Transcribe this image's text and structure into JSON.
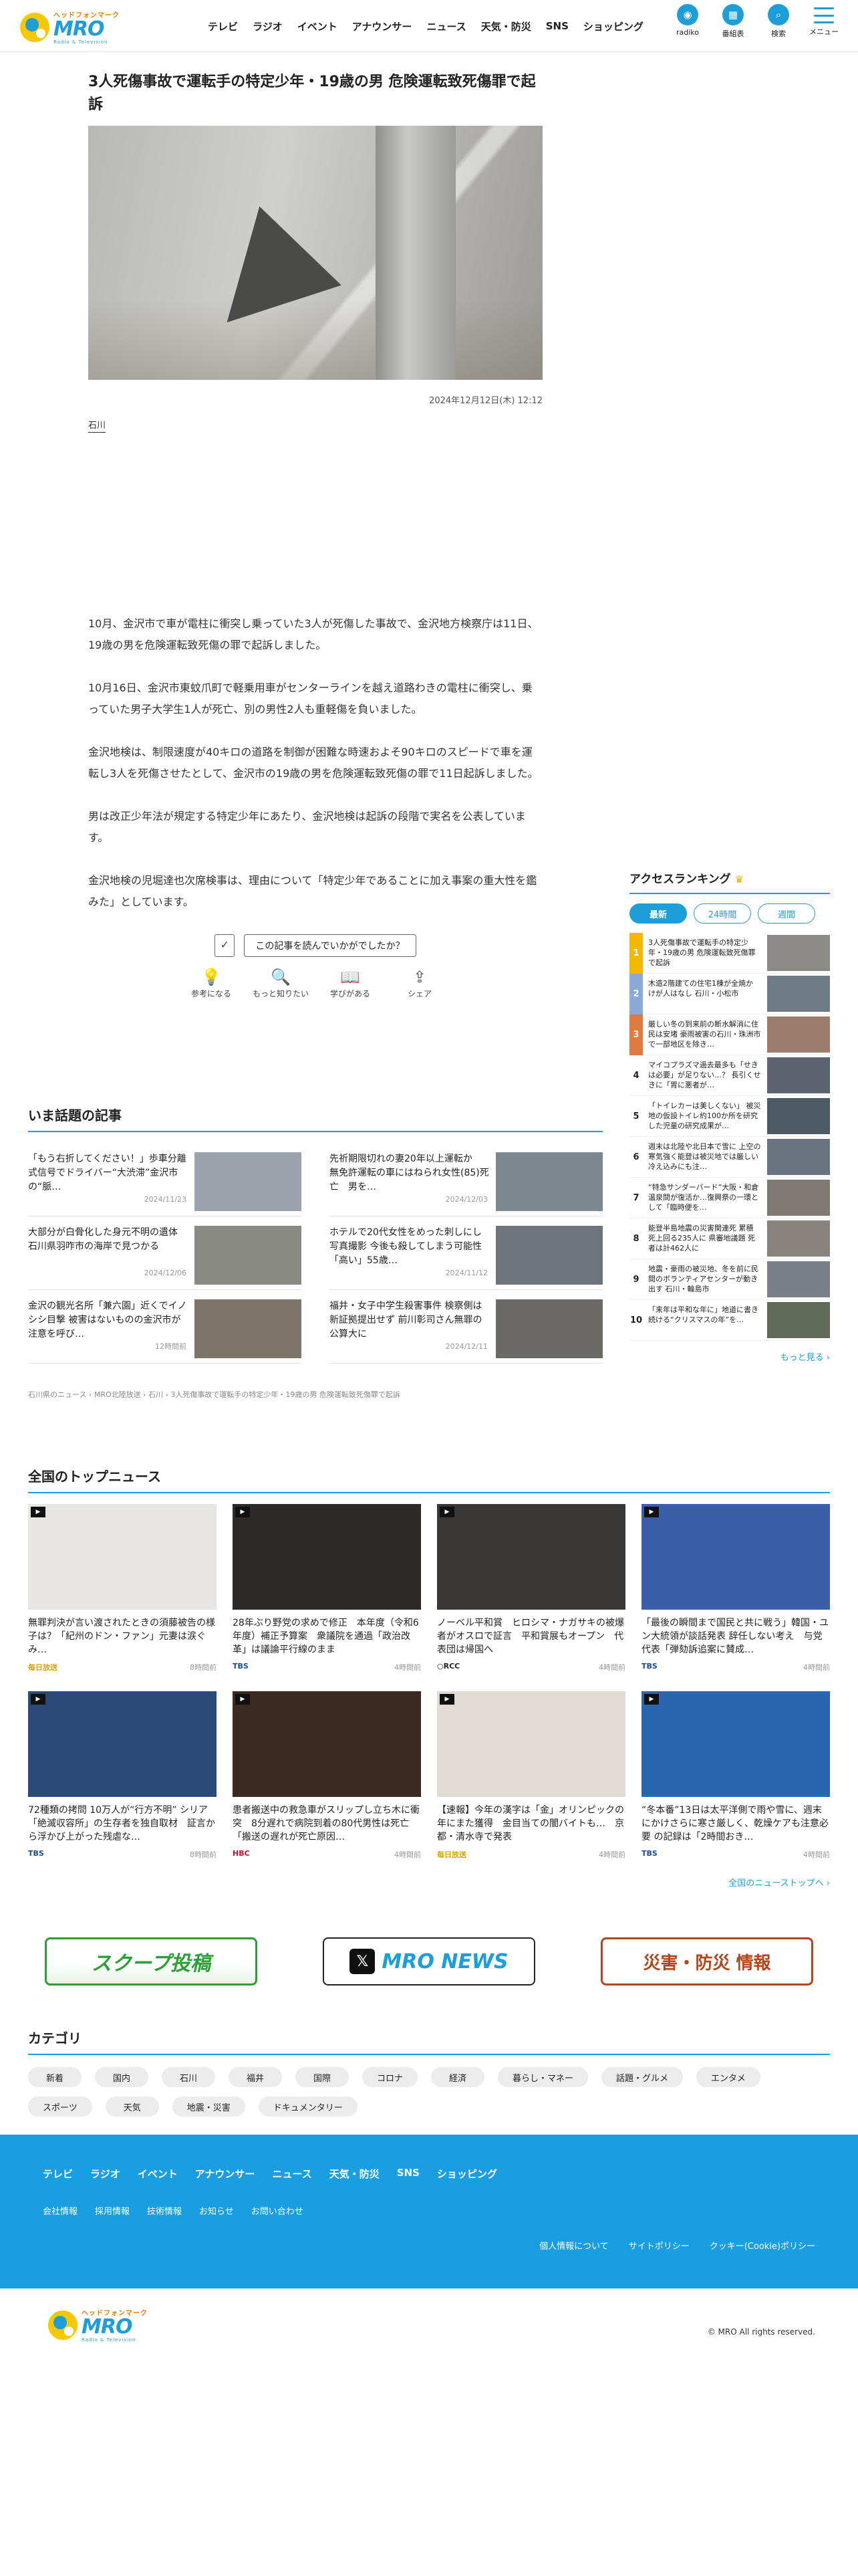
{
  "header": {
    "logo_kana": "ヘッドフォンマーク",
    "logo_name": "MRO",
    "logo_sub": "Radio & Television",
    "nav": [
      "テレビ",
      "ラジオ",
      "イベント",
      "アナウンサー",
      "ニュース",
      "天気・防災",
      "SNS",
      "ショッピング"
    ],
    "icons": [
      {
        "icon": "radiko-icon",
        "label": "radiko"
      },
      {
        "icon": "tv-guide-icon",
        "label": "番組表"
      },
      {
        "icon": "search-icon",
        "label": "検索"
      }
    ],
    "menu_label": "メニュー"
  },
  "article": {
    "title": "3人死傷事故で運転手の特定少年・19歳の男 危険運転致死傷罪で起訴",
    "date": "2024年12月12日(木) 12:12",
    "tag": "石川",
    "paragraphs": [
      "10月、金沢市で車が電柱に衝突し乗っていた3人が死傷した事故で、金沢地方検察庁は11日、19歳の男を危険運転致死傷の罪で起訴しました。",
      "10月16日、金沢市東蚊爪町で軽乗用車がセンターラインを越え道路わきの電柱に衝突し、乗っていた男子大学生1人が死亡、別の男性2人も重軽傷を負いました。",
      "金沢地検は、制限速度が40キロの道路を制御が困難な時速およそ90キロのスピードで車を運転し3人を死傷させたとして、金沢市の19歳の男を危険運転致死傷の罪で11日起訴しました。",
      "男は改正少年法が規定する特定少年にあたり、金沢地検は起訴の段階で実名を公表しています。",
      "金沢地検の児堀達也次席検事は、理由について「特定少年であることに加え事案の重大性を鑑みた」としています。"
    ],
    "feedback_question": "この記事を読んでいかがでしたか？",
    "feedback_buttons": [
      "参考になる",
      "もっと知りたい",
      "学びがある",
      "シェア"
    ]
  },
  "ranking": {
    "title": "アクセスランキング",
    "tabs": [
      "最新",
      "24時間",
      "週間"
    ],
    "items": [
      {
        "rank": "1",
        "title": "3人死傷事故で運転手の特定少年・19歳の男 危険運転致死傷罪で起訴"
      },
      {
        "rank": "2",
        "title": "木造2階建ての住宅1棟が全焼か けが人はなし 石川・小松市"
      },
      {
        "rank": "3",
        "title": "厳しい冬の到来前の断水解消に住民は安堵 豪雨被害の石川・珠洲市で一部地区を除き…"
      },
      {
        "rank": "4",
        "title": "マイコプラズマ過去最多も「せきは必要」が足りない…？ 長引くせきに「胃に悪者が…"
      },
      {
        "rank": "5",
        "title": "「トイレカーは美しくない」 被災地の仮設トイレ約100か所を研究した児童の研究成果が…"
      },
      {
        "rank": "6",
        "title": "週末は北陸や北日本で雪に 上空の寒気強く能登は被災地では厳しい冷え込みにも注…"
      },
      {
        "rank": "7",
        "title": "“特急サンダーバード”大阪・和倉温泉間が復活か…復興祭の一環として「臨時便を…"
      },
      {
        "rank": "8",
        "title": "能登半島地震の災害関連死 累積 死上回る235人に 県審地議題 死者は計462人に"
      },
      {
        "rank": "9",
        "title": "地震・豪雨の被災地、冬を前に民間のボランティアセンターが動き出す 石川・輪島市"
      },
      {
        "rank": "10",
        "title": "「来年は平和な年に」地道に書き続ける“クリスマスの年”を…"
      }
    ],
    "more": "もっと見る"
  },
  "topics": {
    "title": "いま話題の記事",
    "items": [
      {
        "title": "「もう右折してください！」歩車分離式信号でドライバー“大渋滞”金沢市の“脈…",
        "date": "2024/11/23"
      },
      {
        "title": "先祈期限切れの妻20年以上運転か　無免許運転の車にはねられ女性(85)死亡　男を…",
        "date": "2024/12/03"
      },
      {
        "title": "大部分が白骨化した身元不明の遺体 石川県羽咋市の海岸で見つかる",
        "date": "2024/12/06"
      },
      {
        "title": "ホテルで20代女性をめった刺しにし写真撮影 今後も殺してしまう可能性「高い」55歳…",
        "date": "2024/11/12"
      },
      {
        "title": "金沢の観光名所「兼六園」近くでイノシシ目撃 被害はないものの金沢市が注意を呼び…",
        "date": "12時間前"
      },
      {
        "title": "福井・女子中学生殺害事件 検察側は新証拠提出せず 前川彰司さん無罪の公算大に",
        "date": "2024/12/11"
      }
    ],
    "breadcrumb": "石川県のニュース › MRO北陸放送 › 石川 › 3人死傷事故で運転手の特定少年・19歳の男 危険運転致死傷罪で起訴"
  },
  "national": {
    "title": "全国のトップニュース",
    "items": [
      {
        "title": "無罪判決が言い渡されたときの須藤被告の様子は？「紀州のドン・ファン」元妻は涙ぐみ…",
        "source": "毎日放送",
        "ago": "8時間前",
        "src_color": "#d6a400"
      },
      {
        "title": "28年ぶり野党の求めで修正　本年度（令和6年度）補正予算案　衆議院を通過「政治改革」は議論平行線のまま",
        "source": "TBS",
        "ago": "4時間前",
        "src_color": "#1a4c98"
      },
      {
        "title": "ノーベル平和賞　ヒロシマ・ナガサキの被爆者がオスロで証言　平和賞展もオープン　代表団は帰国へ",
        "source": "○RCC",
        "ago": "4時間前",
        "src_color": "#222"
      },
      {
        "title": "「最後の瞬間まで国民と共に戦う」韓国・ユン大統領が談話発表 辞任しない考え　与党代表「弾劾訴追案に賛成…",
        "source": "TBS",
        "ago": "4時間前",
        "src_color": "#1a4c98"
      },
      {
        "title": "72種類の拷問 10万人が“行方不明” シリア「絶滅収容所」の生存者を独自取材　証言から浮かび上がった残虐な…",
        "source": "TBS",
        "ago": "8時間前",
        "src_color": "#1a4c98"
      },
      {
        "title": "患者搬送中の救急車がスリップし立ち木に衝突　8分遅れで病院到着の80代男性は死亡「搬送の遅れが死亡原因…",
        "source": "HBC",
        "ago": "4時間前",
        "src_color": "#c8102e"
      },
      {
        "title": "【速報】今年の漢字は「金」オリンピックの年にまた獲得　金目当ての闇バイトも…　京都・清水寺で発表",
        "source": "毎日放送",
        "ago": "4時間前",
        "src_color": "#d6a400"
      },
      {
        "title": "“冬本番”13日は太平洋側で雨や雪に、週末にかけさらに寒さ厳しく、乾燥ケアも注意必要 の記録は「2時間おき…",
        "source": "TBS",
        "ago": "4時間前",
        "src_color": "#1a4c98"
      }
    ],
    "more": "全国のニューストップへ"
  },
  "banners": [
    "スクープ投稿",
    "MRO NEWS",
    "災害・防災 情報"
  ],
  "category": {
    "title": "カテゴリ",
    "chips": [
      "新着",
      "国内",
      "石川",
      "福井",
      "国際",
      "コロナ",
      "経済",
      "暮らし・マネー",
      "話題・グルメ",
      "エンタメ",
      "スポーツ",
      "天気",
      "地震・災害",
      "ドキュメンタリー"
    ]
  },
  "footer": {
    "nav": [
      "テレビ",
      "ラジオ",
      "イベント",
      "アナウンサー",
      "ニュース",
      "天気・防災",
      "SNS",
      "ショッピング"
    ],
    "links": [
      "会社情報",
      "採用情報",
      "技術情報",
      "お知らせ",
      "お問い合わせ"
    ],
    "policies": [
      "個人情報について",
      "サイトポリシー",
      "クッキー(Cookie)ポリシー"
    ],
    "copyright": "© MRO All rights reserved."
  },
  "colors": {
    "accent": "#1e9ed8",
    "footer_bg": "#1a9ee2",
    "brand_yellow": "#f5c800"
  }
}
